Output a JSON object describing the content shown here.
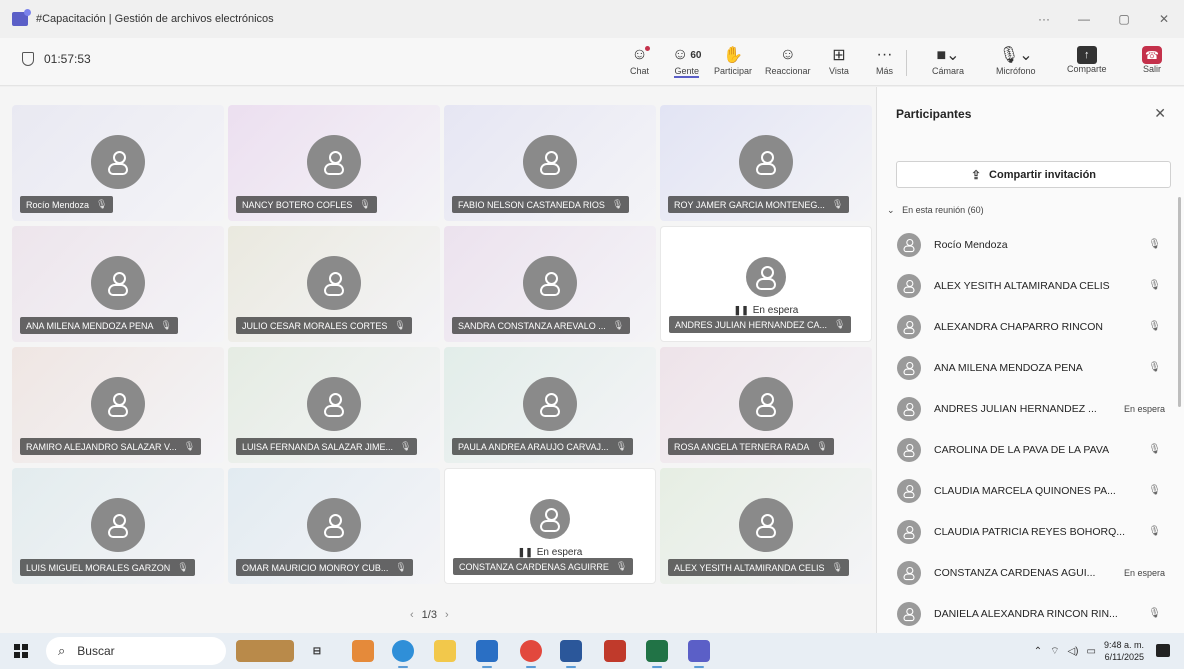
{
  "window": {
    "title": "#Capacitación | Gestión de archivos electrónicos",
    "controls": [
      "···",
      "—",
      "▢",
      "✕"
    ]
  },
  "meeting": {
    "timer": "01:57:53",
    "participant_count": "60",
    "toolbar": {
      "chat": "Chat",
      "people": "Gente",
      "raise": "Participar",
      "react": "Reaccionar",
      "view": "Vista",
      "more": "Más",
      "camera": "Cámara",
      "mic": "Micrófono",
      "share": "Comparte",
      "leave": "Salir"
    }
  },
  "grid": {
    "tiles": [
      {
        "name": "Rocío Mendoza",
        "waiting": false,
        "bg": "#e9e9f2"
      },
      {
        "name": "NANCY BOTERO COFLES",
        "waiting": false,
        "bg": "#ecdff0"
      },
      {
        "name": "FABIO NELSON CASTANEDA RIOS",
        "waiting": false,
        "bg": "#e6e6f3"
      },
      {
        "name": "ROY JAMER GARCIA MONTENEG...",
        "waiting": false,
        "bg": "#e2e4f4"
      },
      {
        "name": "ANA MILENA MENDOZA PENA",
        "waiting": false,
        "bg": "#ede5ec"
      },
      {
        "name": "JULIO CESAR MORALES CORTES",
        "waiting": false,
        "bg": "#eae9df"
      },
      {
        "name": "SANDRA CONSTANZA AREVALO ...",
        "waiting": false,
        "bg": "#ece2ee"
      },
      {
        "name": "ANDRES JULIAN HERNANDEZ CA...",
        "waiting": true,
        "bg": "#ffffff"
      },
      {
        "name": "RAMIRO ALEJANDRO SALAZAR V...",
        "waiting": false,
        "bg": "#efe6e3"
      },
      {
        "name": "LUISA FERNANDA SALAZAR JIME...",
        "waiting": false,
        "bg": "#e5ece3"
      },
      {
        "name": "PAULA ANDREA ARAUJO CARVAJ...",
        "waiting": false,
        "bg": "#e2ede9"
      },
      {
        "name": "ROSA ANGELA TERNERA RADA",
        "waiting": false,
        "bg": "#eee3e9"
      },
      {
        "name": "LUIS MIGUEL MORALES GARZON",
        "waiting": false,
        "bg": "#e3ecee"
      },
      {
        "name": "OMAR MAURICIO MONROY CUB...",
        "waiting": false,
        "bg": "#e2ebf1"
      },
      {
        "name": "CONSTANZA CARDENAS AGUIRRE",
        "waiting": true,
        "bg": "#ffffff"
      },
      {
        "name": "ALEX YESITH ALTAMIRANDA CELIS",
        "waiting": false,
        "bg": "#e6eee3"
      }
    ],
    "waiting_label": "En espera",
    "pager": "1/3"
  },
  "panel": {
    "title": "Participantes",
    "invite": "Compartir invitación",
    "section": "En esta reunión (60)",
    "participants": [
      {
        "name": "Rocío Mendoza",
        "status": ""
      },
      {
        "name": "ALEX YESITH ALTAMIRANDA CELIS",
        "status": ""
      },
      {
        "name": "ALEXANDRA CHAPARRO RINCON",
        "status": ""
      },
      {
        "name": "ANA MILENA MENDOZA PENA",
        "status": ""
      },
      {
        "name": "ANDRES JULIAN HERNANDEZ ...",
        "status": "En espera"
      },
      {
        "name": "CAROLINA DE LA PAVA DE LA PAVA",
        "status": ""
      },
      {
        "name": "CLAUDIA MARCELA QUINONES PA...",
        "status": ""
      },
      {
        "name": "CLAUDIA PATRICIA REYES BOHORQ...",
        "status": ""
      },
      {
        "name": "CONSTANZA CARDENAS AGUI...",
        "status": "En espera"
      },
      {
        "name": "DANIELA ALEXANDRA RINCON RIN...",
        "status": ""
      }
    ]
  },
  "taskbar": {
    "search": "Buscar",
    "time": "9:48 a. m.",
    "date": "6/11/2025"
  }
}
